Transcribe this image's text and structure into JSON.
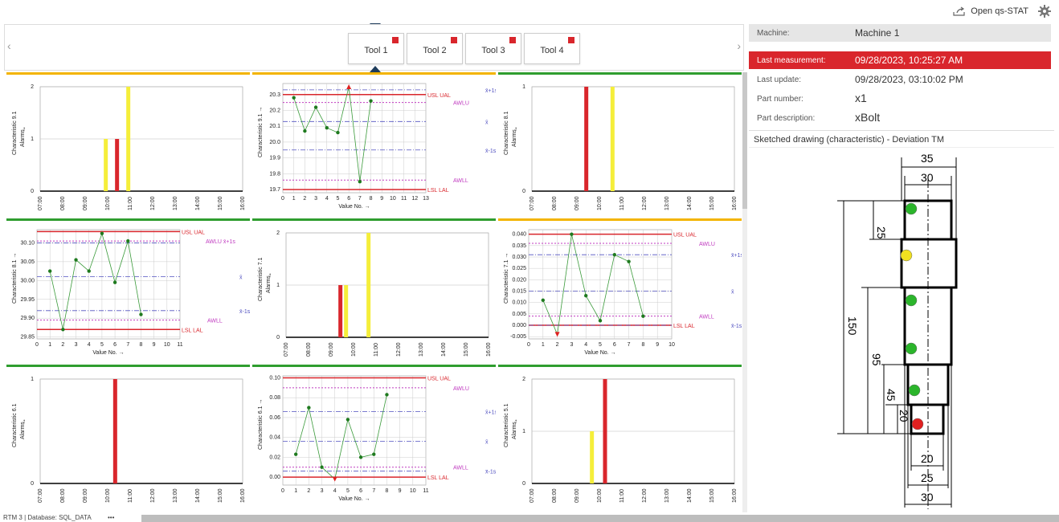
{
  "header": {
    "open_label": "Open qs-STAT",
    "export_icon": "export-icon",
    "settings_icon": "gear-icon"
  },
  "tabs": [
    {
      "label": "Tool 1",
      "alarm": true,
      "active": true
    },
    {
      "label": "Tool 2",
      "alarm": true
    },
    {
      "label": "Tool 3",
      "alarm": true
    },
    {
      "label": "Tool 4",
      "alarm": true
    }
  ],
  "info": {
    "machine_label": "Machine:",
    "machine_value": "Machine 1",
    "last_meas_label": "Last measurement:",
    "last_meas_value": "09/28/2023, 10:25:27 AM",
    "last_update_label": "Last update:",
    "last_update_value": "09/28/2023, 03:10:02 PM",
    "part_number_label": "Part number:",
    "part_number_value": "x1",
    "part_desc_label": "Part description:",
    "part_desc_value": "xBolt"
  },
  "sketch": {
    "title": "Sketched drawing (characteristic) - Deviation TM",
    "dims": [
      "35",
      "30",
      "25",
      "150",
      "95",
      "45",
      "20",
      "20",
      "25",
      "30"
    ],
    "markers": [
      {
        "color": "#2bb52b"
      },
      {
        "color": "#f0e020"
      },
      {
        "color": "#2bb52b"
      },
      {
        "color": "#2bb52b"
      },
      {
        "color": "#2bb52b"
      },
      {
        "color": "#e02020"
      }
    ]
  },
  "status": {
    "text": "RTM 3 | Database: SQL_DATA"
  },
  "colors": {
    "alarm": "#d9262c",
    "warn": "#f5ee3a",
    "ok": "#2f9d2f",
    "border_warn": "#f3b400"
  },
  "chart_data": [
    {
      "type": "bar",
      "ylabel": "Characteristic 9.1 ↑ Alarms",
      "categories": [
        "07:00",
        "08:00",
        "09:00",
        "10:00",
        "11:00",
        "12:00",
        "13:00",
        "14:00",
        "15:00",
        "16:00"
      ],
      "ylim": [
        0,
        2
      ],
      "yticks": [
        "0",
        "1",
        "2"
      ],
      "series": [
        {
          "name": "warning",
          "color": "#f5ee3a",
          "points": [
            [
              "09:55",
              1
            ],
            [
              "10:55",
              2
            ]
          ]
        },
        {
          "name": "alarm",
          "color": "#d9262c",
          "points": [
            [
              "10:25",
              1
            ]
          ]
        }
      ],
      "border": "#f3b400"
    },
    {
      "type": "line",
      "ylabel": "Characteristic 9.1 →",
      "xlabel": "Value No. →",
      "x": [
        1,
        2,
        3,
        4,
        5,
        6,
        7,
        8
      ],
      "values": [
        20.28,
        20.07,
        20.22,
        20.09,
        20.06,
        20.35,
        19.75,
        20.26
      ],
      "ylim": [
        19.68,
        20.37
      ],
      "yticks": [
        "19.7",
        "19.8",
        "19.9",
        "20.0",
        "20.1",
        "20.2",
        "20.3"
      ],
      "xticks": [
        "0",
        "1",
        "2",
        "3",
        "4",
        "5",
        "6",
        "7",
        "8",
        "9",
        "10",
        "11",
        "12",
        "13"
      ],
      "xmax": 13,
      "limits": {
        "usl": 20.3,
        "awlu": 20.25,
        "xbar": 20.13,
        "xbar_minus": 19.95,
        "awll": 19.76,
        "lsl": 19.7,
        "xbar_plus": 20.33
      },
      "labels": {
        "usl": "USL UAL",
        "awlu": "AWLU",
        "xbar": "x̄",
        "xbar_minus": "x̄-1s",
        "awll": "AWLL",
        "lsl": "LSL LAL",
        "xbar_plus": "x̄+1s"
      },
      "border": "#f3b400"
    },
    {
      "type": "bar",
      "ylabel": "Characteristic 8.1 ↑ Alarms",
      "categories": [
        "07:00",
        "08:00",
        "09:00",
        "10:00",
        "11:00",
        "12:00",
        "13:00",
        "14:00",
        "15:00",
        "16:00"
      ],
      "ylim": [
        0,
        1
      ],
      "yticks": [
        "0",
        "1"
      ],
      "series": [
        {
          "name": "alarm",
          "color": "#d9262c",
          "points": [
            [
              "09:25",
              1
            ]
          ]
        },
        {
          "name": "warning",
          "color": "#f5ee3a",
          "points": [
            [
              "10:35",
              1
            ]
          ]
        }
      ],
      "border": "#2f9d2f"
    },
    {
      "type": "line",
      "ylabel": "Characteristic 8.1 →",
      "xlabel": "Value No. →",
      "x": [
        1,
        2,
        3,
        4,
        5,
        6,
        7,
        8
      ],
      "values": [
        30.025,
        29.87,
        30.055,
        30.025,
        30.125,
        29.995,
        30.105,
        29.91
      ],
      "ylim": [
        29.845,
        30.135
      ],
      "yticks": [
        "29.85",
        "29.90",
        "29.95",
        "30.00",
        "30.05",
        "30.10"
      ],
      "xticks": [
        "0",
        "1",
        "2",
        "3",
        "4",
        "5",
        "6",
        "7",
        "8",
        "9",
        "10",
        "11"
      ],
      "xmax": 11,
      "limits": {
        "usl": 30.13,
        "awlu": 30.105,
        "xbar": 30.01,
        "xbar_minus": 29.92,
        "awll": 29.895,
        "lsl": 29.87,
        "xbar_plus": 30.1
      },
      "labels": {
        "usl": "USL UAL",
        "awlu": "AWLU x̄+1s",
        "xbar": "x̄",
        "xbar_minus": "x̄-1s",
        "awll": "AWLL",
        "lsl": "LSL LAL",
        "xbar_plus": ""
      },
      "border": "#2f9d2f"
    },
    {
      "type": "bar",
      "ylabel": "Characteristic 7.1 ↑ Alarms",
      "categories": [
        "07:00",
        "08:00",
        "09:00",
        "10:00",
        "11:00",
        "12:00",
        "13:00",
        "14:00",
        "15:00",
        "16:00"
      ],
      "ylim": [
        0,
        2
      ],
      "yticks": [
        "0",
        "1",
        "2"
      ],
      "series": [
        {
          "name": "alarm",
          "color": "#d9262c",
          "points": [
            [
              "09:25",
              1
            ]
          ]
        },
        {
          "name": "warning",
          "color": "#f5ee3a",
          "points": [
            [
              "09:40",
              1
            ],
            [
              "10:40",
              2
            ]
          ]
        }
      ],
      "border": "#2f9d2f"
    },
    {
      "type": "line",
      "ylabel": "Characteristic 7.1 →",
      "xlabel": "Value No. →",
      "x": [
        1,
        2,
        3,
        4,
        5,
        6,
        7,
        8
      ],
      "values": [
        0.011,
        -0.004,
        0.04,
        0.013,
        0.002,
        0.031,
        0.028,
        0.004
      ],
      "ylim": [
        -0.006,
        0.042
      ],
      "yticks": [
        "-0.005",
        "0.000",
        "0.005",
        "0.010",
        "0.015",
        "0.020",
        "0.025",
        "0.030",
        "0.035",
        "0.040"
      ],
      "xticks": [
        "0",
        "1",
        "2",
        "3",
        "4",
        "5",
        "6",
        "7",
        "8",
        "9",
        "10"
      ],
      "xmax": 10,
      "limits": {
        "usl": 0.04,
        "awlu": 0.036,
        "xbar": 0.015,
        "xbar_minus": 0.0,
        "awll": 0.004,
        "lsl": 0.0,
        "xbar_plus": 0.031
      },
      "labels": {
        "usl": "USL UAL",
        "awlu": "AWLU",
        "xbar": "x̄",
        "xbar_minus": "x̄-1s",
        "awll": "AWLL",
        "lsl": "LSL LAL",
        "xbar_plus": "x̄+1s"
      },
      "border": "#f3b400"
    },
    {
      "type": "bar",
      "ylabel": "Characteristic 6.1 ↑ Alarms",
      "categories": [
        "07:00",
        "08:00",
        "09:00",
        "10:00",
        "11:00",
        "12:00",
        "13:00",
        "14:00",
        "15:00",
        "16:00"
      ],
      "ylim": [
        0,
        1
      ],
      "yticks": [
        "0",
        "1"
      ],
      "series": [
        {
          "name": "alarm",
          "color": "#d9262c",
          "points": [
            [
              "10:20",
              1
            ]
          ]
        }
      ],
      "border": "#2f9d2f"
    },
    {
      "type": "line",
      "ylabel": "Characteristic 6.1 →",
      "xlabel": "Value No. →",
      "x": [
        1,
        2,
        3,
        4,
        5,
        6,
        7,
        8
      ],
      "values": [
        0.023,
        0.07,
        0.01,
        -0.002,
        0.058,
        0.02,
        0.023,
        0.083
      ],
      "ylim": [
        -0.008,
        0.102
      ],
      "yticks": [
        "0.00",
        "0.02",
        "0.04",
        "0.06",
        "0.08",
        "0.10"
      ],
      "xticks": [
        "0",
        "1",
        "2",
        "3",
        "4",
        "5",
        "6",
        "7",
        "8",
        "9",
        "10",
        "11"
      ],
      "xmax": 11,
      "limits": {
        "usl": 0.1,
        "awlu": 0.09,
        "xbar": 0.036,
        "xbar_minus": 0.006,
        "awll": 0.01,
        "lsl": 0.0,
        "xbar_plus": 0.066
      },
      "labels": {
        "usl": "USL UAL",
        "awlu": "AWLU",
        "xbar": "x̄",
        "xbar_minus": "x̄-1s",
        "awll": "AWLL",
        "lsl": "LSL LAL",
        "xbar_plus": "x̄+1s"
      },
      "border": "#2f9d2f"
    },
    {
      "type": "bar",
      "ylabel": "Characteristic 5.1 ↑ Alarms",
      "categories": [
        "07:00",
        "08:00",
        "09:00",
        "10:00",
        "11:00",
        "12:00",
        "13:00",
        "14:00",
        "15:00",
        "16:00"
      ],
      "ylim": [
        0,
        2
      ],
      "yticks": [
        "0",
        "1",
        "2"
      ],
      "series": [
        {
          "name": "warning",
          "color": "#f5ee3a",
          "points": [
            [
              "09:40",
              1
            ]
          ]
        },
        {
          "name": "alarm",
          "color": "#d9262c",
          "points": [
            [
              "10:15",
              2
            ]
          ]
        }
      ],
      "border": "#2f9d2f"
    }
  ]
}
